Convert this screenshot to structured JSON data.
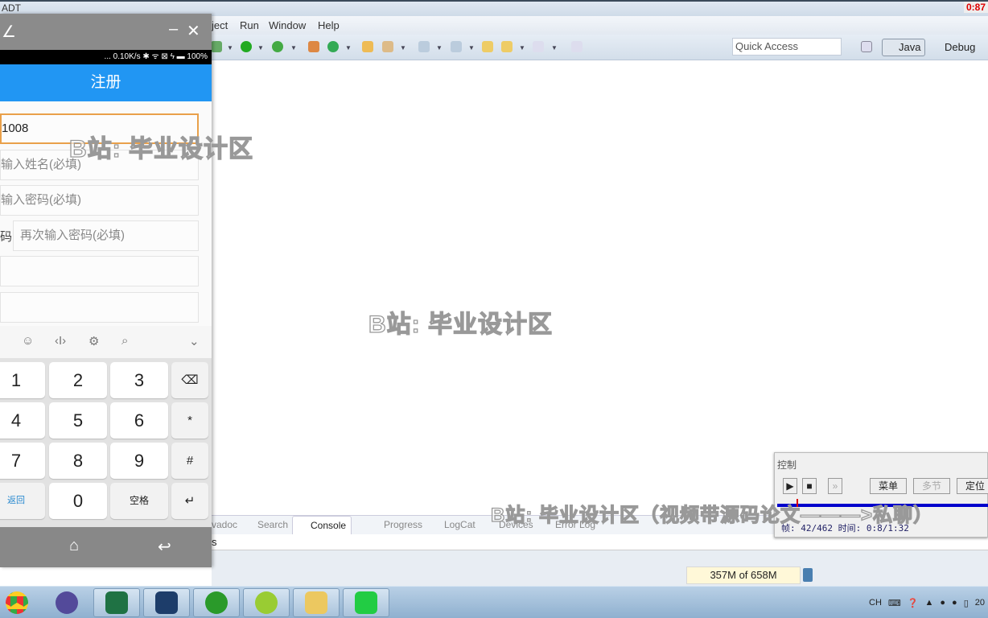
{
  "window": {
    "title": "ADT",
    "recorder_badge": "0:87"
  },
  "menu": [
    "ject",
    "Run",
    "Window",
    "Help"
  ],
  "toolbar": {
    "quick_access": "Quick Access",
    "perspectives": [
      {
        "label": "Java",
        "active": true
      },
      {
        "label": "Debug",
        "active": false
      }
    ]
  },
  "views": {
    "tabs": [
      "vadoc",
      "Search",
      "Console",
      "Progress",
      "LogCat",
      "Devices",
      "Error Log"
    ],
    "active": "Console",
    "console_text": "s"
  },
  "status": {
    "memory": "357M of 658M"
  },
  "phone": {
    "status_text": "... 0.10K/s ✱ ᯤ ⊠ ϟ ▬ 100%",
    "header_title": "注册",
    "fields": [
      {
        "value": "1008",
        "placeholder": "",
        "focused": true
      },
      {
        "placeholder": "输入姓名(必填)"
      },
      {
        "placeholder": "输入密码(必填)"
      },
      {
        "label": "码:",
        "placeholder": "再次输入密码(必填)"
      },
      {
        "placeholder": ""
      },
      {
        "placeholder": ""
      }
    ],
    "keyboard": {
      "toolbar_icons": [
        "emoji-icon",
        "cursor-icon",
        "gear-icon",
        "search-icon",
        "chevron-down-icon"
      ],
      "keys": [
        [
          "1",
          "2",
          "3",
          "⌫"
        ],
        [
          "4",
          "5",
          "6",
          "*"
        ],
        [
          "7",
          "8",
          "9",
          "#"
        ],
        [
          "返回",
          "0",
          "空格",
          "↵"
        ]
      ]
    }
  },
  "control_panel": {
    "title": "控制",
    "buttons": [
      "菜单",
      "多节",
      "定位"
    ],
    "progress": 0.09,
    "info": "帧: 42/462 时间: 0:8/1:32",
    "accent": "#0000cc"
  },
  "watermarks": [
    "B站: 毕业设计区",
    "B站: 毕业设计区",
    "B站: 毕业设计区（视频带源码论文———>私聊）"
  ],
  "taskbar": {
    "apps": [
      "chrome",
      "eclipse",
      "excel",
      "app-8",
      "app-green",
      "app-braces",
      "explorer",
      "app-phone"
    ],
    "tray_lang": "CH",
    "clock": "20"
  }
}
